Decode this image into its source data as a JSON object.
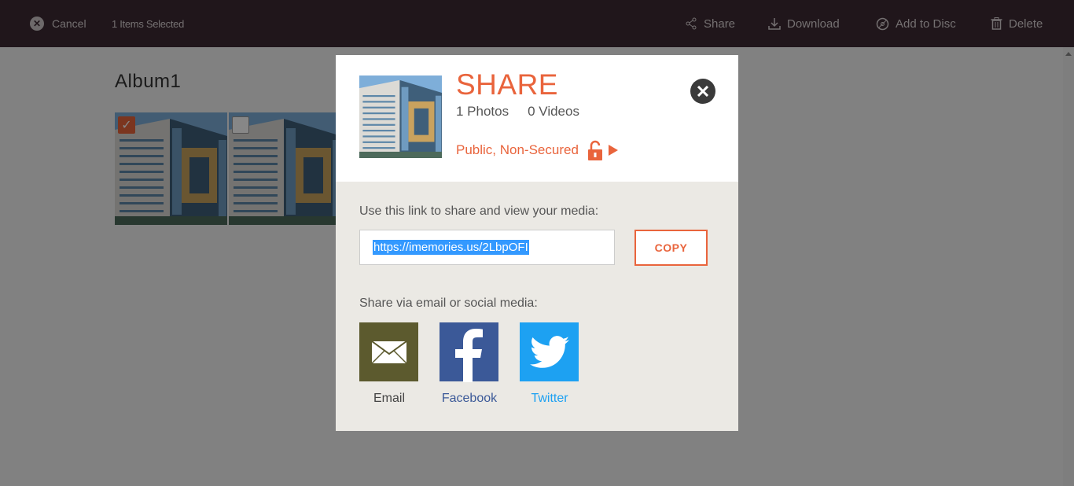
{
  "topbar": {
    "cancel_label": "Cancel",
    "selected_label": "1 Items Selected",
    "share_label": "Share",
    "download_label": "Download",
    "add_to_disc_label": "Add to Disc",
    "delete_label": "Delete"
  },
  "album": {
    "title": "Album1",
    "photos": [
      {
        "selected": true,
        "check_glyph": "✓"
      },
      {
        "selected": false
      }
    ]
  },
  "share_modal": {
    "title": "SHARE",
    "photos_count": "1 Photos",
    "videos_count": "0 Videos",
    "privacy_label": "Public, Non-Secured",
    "link_label": "Use this link to share and view your media:",
    "link_value": "https://imemories.us/2LbpOFI",
    "copy_label": "COPY",
    "social_label": "Share via email or social media:",
    "social": {
      "email_label": "Email",
      "facebook_label": "Facebook",
      "twitter_label": "Twitter"
    }
  },
  "colors": {
    "accent": "#e9643c",
    "topbar_bg": "#3d2b33",
    "email_tile": "#5c5a2e",
    "facebook_tile": "#3b5998",
    "twitter_tile": "#1da1f2"
  },
  "icons": [
    "close-icon",
    "share-icon",
    "download-icon",
    "disc-icon",
    "trash-icon",
    "lock-open-icon",
    "play-arrow-icon",
    "envelope-icon",
    "facebook-icon",
    "twitter-icon",
    "checkmark-icon"
  ]
}
